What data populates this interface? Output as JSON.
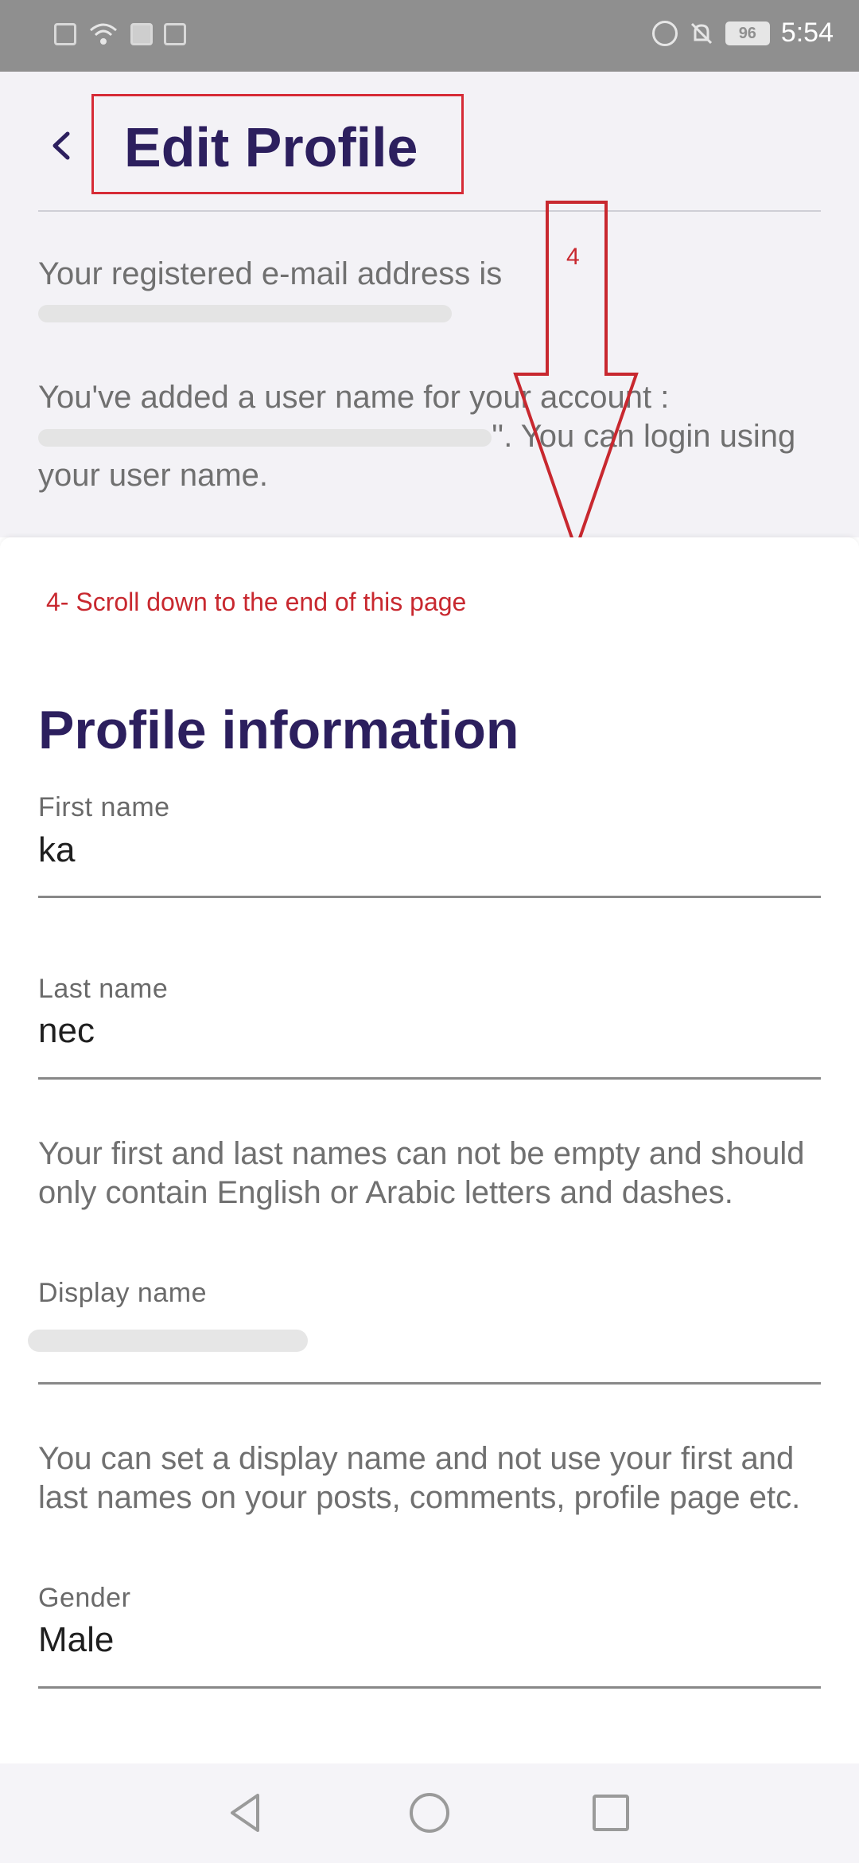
{
  "status_bar": {
    "time": "5:54",
    "battery": "96",
    "left_icons": [
      "alert-icon",
      "wifi-icon",
      "app-icon",
      "mail-icon"
    ],
    "right_icons": [
      "alarm-icon",
      "mute-icon",
      "battery-icon"
    ]
  },
  "header": {
    "title": "Edit Profile",
    "back_icon": "chevron-left-icon"
  },
  "account_info": {
    "email_prefix": "Your registered e-mail address is",
    "username_prefix": "You've added a user name for your account :",
    "username_suffix": "''. You can login using your user name."
  },
  "annotation": {
    "step_number": "4",
    "instruction": "4- Scroll down to the end of this page",
    "color": "#c8282f"
  },
  "profile": {
    "section_title": "Profile information",
    "first_name_label": "First name",
    "first_name_value": "ka",
    "last_name_label": "Last name",
    "last_name_value": "nec",
    "names_hint": "Your first and last names can not be empty and should only contain English or Arabic letters and dashes.",
    "display_name_label": "Display name",
    "display_name_hint": "You can set a display name and not use your first and last names on your posts, comments, profile page etc.",
    "gender_label": "Gender",
    "gender_value": "Male"
  },
  "nav_bar": {
    "buttons": [
      "back-triangle-icon",
      "home-circle-icon",
      "recents-square-icon"
    ]
  },
  "colors": {
    "title": "#2c1f5e",
    "annotation": "#c8282f"
  }
}
